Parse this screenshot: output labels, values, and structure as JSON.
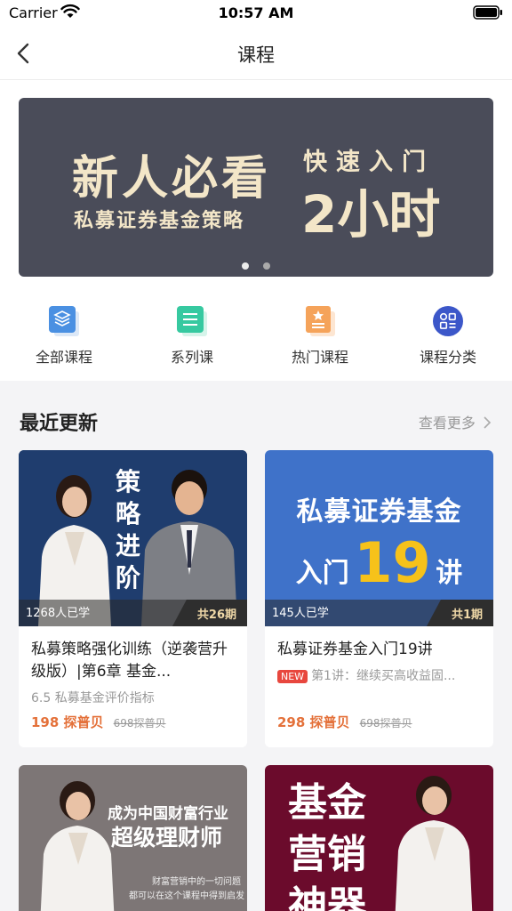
{
  "status": {
    "carrier": "Carrier",
    "time": "10:57 AM"
  },
  "nav": {
    "title": "课程"
  },
  "banner": {
    "line1": "新人必看",
    "line2": "私募证券基金策略",
    "line3": "快速入门",
    "line4": "2小时"
  },
  "quick_nav": [
    {
      "label": "全部课程",
      "icon": "layers-icon",
      "color": "#4a90e2"
    },
    {
      "label": "系列课",
      "icon": "list-icon",
      "color": "#36c9a0"
    },
    {
      "label": "热门课程",
      "icon": "star-doc-icon",
      "color": "#f5a35a"
    },
    {
      "label": "课程分类",
      "icon": "category-icon",
      "color": "#3c57c9"
    }
  ],
  "section": {
    "title": "最近更新",
    "more": "查看更多"
  },
  "cards": [
    {
      "cover_text": [
        "策",
        "略",
        "进",
        "阶"
      ],
      "learners": "1268人已学",
      "episodes": "共26期",
      "title": "私募策略强化训练（逆袭营升级版）|第6章 基金...",
      "subtitle": "6.5 私募基金评价指标",
      "price": "198 探普贝",
      "old_price": "698探普贝"
    },
    {
      "cover_line1": "私募证券基金",
      "cover_line2a": "入门",
      "cover_line2b": "19",
      "cover_line2c": "讲",
      "learners": "145人已学",
      "episodes": "共1期",
      "title": "私募证券基金入门19讲",
      "badge": "NEW",
      "subtitle": "第1讲：继续买高收益固...",
      "price": "298 探普贝",
      "old_price": "698探普贝"
    },
    {
      "cover_line1": "成为中国财富行业",
      "cover_line2": "超级理财师",
      "cover_line3": "财富营销中的一切问题",
      "cover_line4": "都可以在这个课程中得到启发"
    },
    {
      "cover_text": [
        "基金",
        "营销",
        "神器"
      ]
    }
  ],
  "colors": {
    "accent_price": "#e4713a",
    "banner_bg": "#4a4c59",
    "banner_text": "#f3e6c8"
  }
}
